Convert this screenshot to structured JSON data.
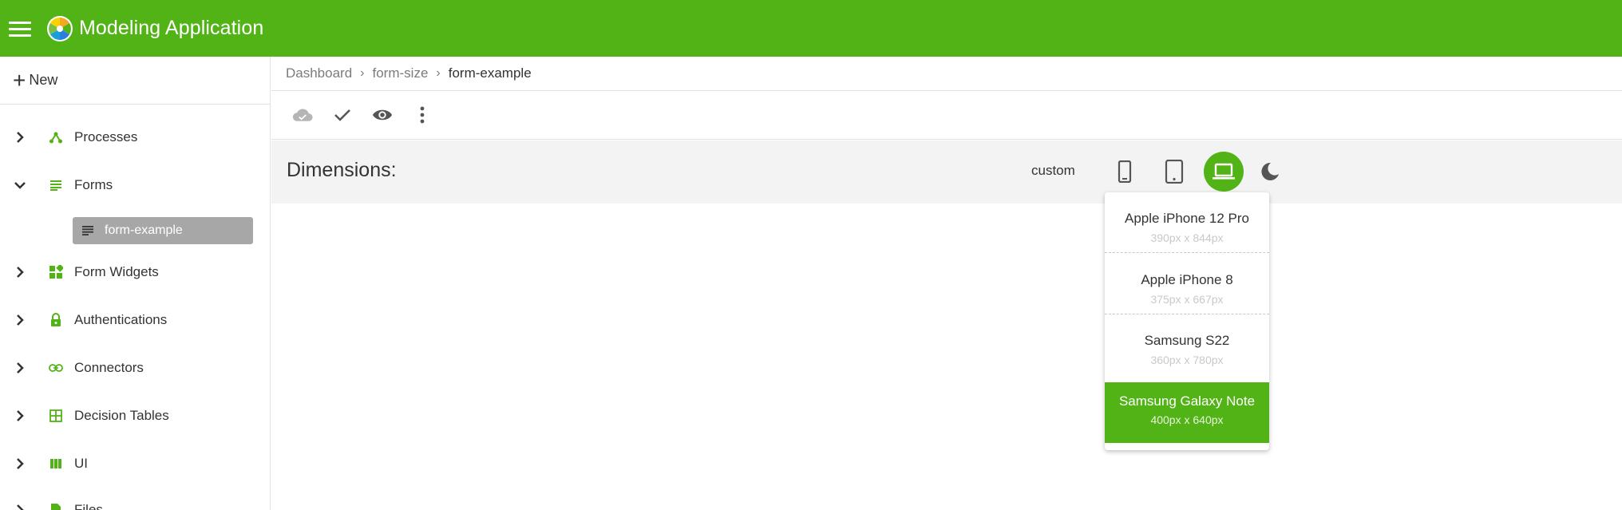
{
  "app": {
    "title": "Modeling Application",
    "brand_color": "#52b316"
  },
  "sidebar": {
    "new_label": "New",
    "items": [
      {
        "label": "Processes",
        "icon": "processes-icon",
        "expanded": false
      },
      {
        "label": "Forms",
        "icon": "forms-icon",
        "expanded": true
      },
      {
        "label": "Form Widgets",
        "icon": "widgets-icon",
        "expanded": false
      },
      {
        "label": "Authentications",
        "icon": "lock-icon",
        "expanded": false
      },
      {
        "label": "Connectors",
        "icon": "link-icon",
        "expanded": false
      },
      {
        "label": "Decision Tables",
        "icon": "table-icon",
        "expanded": false
      },
      {
        "label": "UI",
        "icon": "ui-icon",
        "expanded": false
      },
      {
        "label": "Files",
        "icon": "file-icon",
        "expanded": false
      }
    ],
    "selected_child": {
      "label": "form-example",
      "icon": "form-icon"
    }
  },
  "breadcrumb": [
    "Dashboard",
    "form-size",
    "form-example"
  ],
  "toolbar": {
    "icons": [
      "cloud-check-icon",
      "check-icon",
      "eye-icon",
      "more-vert-icon"
    ]
  },
  "dimensions": {
    "title": "Dimensions:",
    "custom_label": "custom",
    "buttons": [
      "phone-icon",
      "tablet-icon",
      "laptop-icon",
      "dark-mode-icon"
    ],
    "active": "laptop-icon"
  },
  "dropdown": {
    "items": [
      {
        "name": "Apple iPhone 12 Pro",
        "size": "390px x 844px",
        "selected": false
      },
      {
        "name": "Apple iPhone 8",
        "size": "375px x 667px",
        "selected": false
      },
      {
        "name": "Samsung S22",
        "size": "360px x 780px",
        "selected": false
      },
      {
        "name": "Samsung Galaxy Note",
        "size": "400px x 640px",
        "selected": true
      }
    ]
  }
}
